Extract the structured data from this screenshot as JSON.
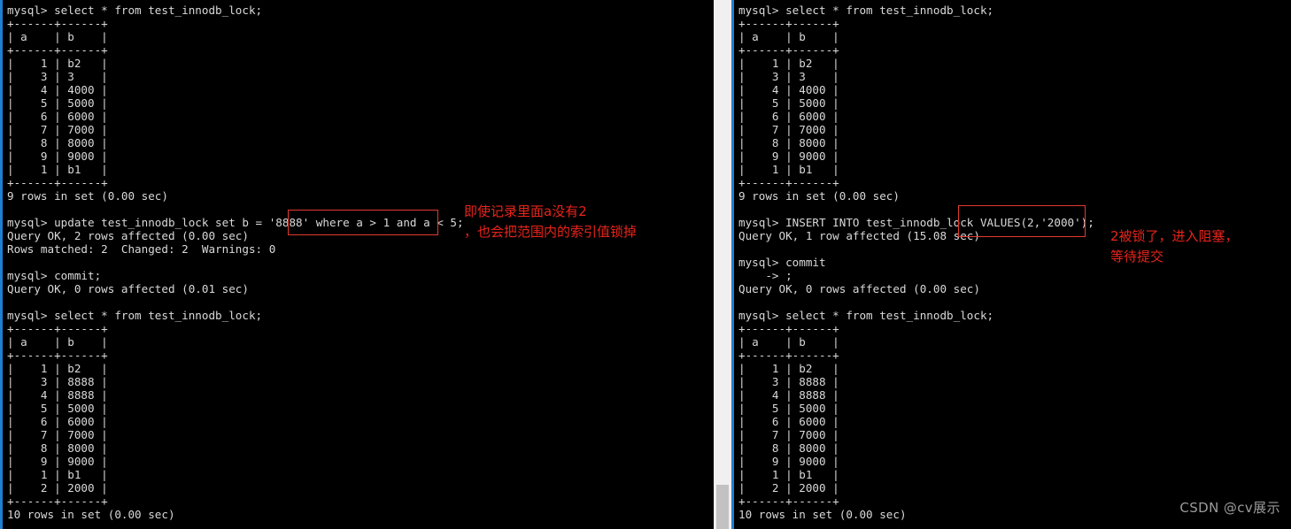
{
  "meta": {
    "watermark": "CSDN @cv展示"
  },
  "colors": {
    "terminal_background": "#000000",
    "terminal_text": "#d9d9d9",
    "pane_border": "#1f7fd0",
    "annotation_red": "#e8241b",
    "box_red": "#e23a2e",
    "scrollbar_track": "#f0f0f0",
    "scrollbar_thumb": "#c2c2c2",
    "watermark_text": "#9b9b9b"
  },
  "left_pane": {
    "name": "session-a-terminal",
    "session_text": "mysql> select * from test_innodb_lock;\n+------+------+\n| a    | b    |\n+------+------+\n|    1 | b2   |\n|    3 | 3    |\n|    4 | 4000 |\n|    5 | 5000 |\n|    6 | 6000 |\n|    7 | 7000 |\n|    8 | 8000 |\n|    9 | 9000 |\n|    1 | b1   |\n+------+------+\n9 rows in set (0.00 sec)\n\nmysql> update test_innodb_lock set b = '8888' where a > 1 and a < 5;\nQuery OK, 2 rows affected (0.00 sec)\nRows matched: 2  Changed: 2  Warnings: 0\n\nmysql> commit;\nQuery OK, 0 rows affected (0.01 sec)\n\nmysql> select * from test_innodb_lock;\n+------+------+\n| a    | b    |\n+------+------+\n|    1 | b2   |\n|    3 | 8888 |\n|    4 | 8888 |\n|    5 | 5000 |\n|    6 | 6000 |\n|    7 | 7000 |\n|    8 | 8000 |\n|    9 | 9000 |\n|    1 | b1   |\n|    2 | 2000 |\n+------+------+\n10 rows in set (0.00 sec)",
    "commands": [
      {
        "prompt": "mysql>",
        "sql": "select * from test_innodb_lock;",
        "result_table": {
          "headers": [
            "a",
            "b"
          ],
          "rows": [
            [
              "1",
              "b2"
            ],
            [
              "3",
              "3"
            ],
            [
              "4",
              "4000"
            ],
            [
              "5",
              "5000"
            ],
            [
              "6",
              "6000"
            ],
            [
              "7",
              "7000"
            ],
            [
              "8",
              "8000"
            ],
            [
              "9",
              "9000"
            ],
            [
              "1",
              "b1"
            ]
          ]
        },
        "status": "9 rows in set (0.00 sec)"
      },
      {
        "prompt": "mysql>",
        "sql": "update test_innodb_lock set b = '8888' where a > 1 and a < 5;",
        "status": "Query OK, 2 rows affected (0.00 sec)",
        "extra": "Rows matched: 2  Changed: 2  Warnings: 0"
      },
      {
        "prompt": "mysql>",
        "sql": "commit;",
        "status": "Query OK, 0 rows affected (0.01 sec)"
      },
      {
        "prompt": "mysql>",
        "sql": "select * from test_innodb_lock;",
        "result_table": {
          "headers": [
            "a",
            "b"
          ],
          "rows": [
            [
              "1",
              "b2"
            ],
            [
              "3",
              "8888"
            ],
            [
              "4",
              "8888"
            ],
            [
              "5",
              "5000"
            ],
            [
              "6",
              "6000"
            ],
            [
              "7",
              "7000"
            ],
            [
              "8",
              "8000"
            ],
            [
              "9",
              "9000"
            ],
            [
              "1",
              "b1"
            ],
            [
              "2",
              "2000"
            ]
          ]
        },
        "status": "10 rows in set (0.00 sec)"
      }
    ],
    "highlight_box_text": "where a > 1 and a < 5;",
    "annotation": "即使记录里面a没有2\n，也会把范围内的索引值锁掉"
  },
  "right_pane": {
    "name": "session-b-terminal",
    "session_text": "mysql> select * from test_innodb_lock;\n+------+------+\n| a    | b    |\n+------+------+\n|    1 | b2   |\n|    3 | 3    |\n|    4 | 4000 |\n|    5 | 5000 |\n|    6 | 6000 |\n|    7 | 7000 |\n|    8 | 8000 |\n|    9 | 9000 |\n|    1 | b1   |\n+------+------+\n9 rows in set (0.00 sec)\n\nmysql> INSERT INTO test_innodb_lock VALUES(2,'2000');\nQuery OK, 1 row affected (15.08 sec)\n\nmysql> commit\n    -> ;\nQuery OK, 0 rows affected (0.00 sec)\n\nmysql> select * from test_innodb_lock;\n+------+------+\n| a    | b    |\n+------+------+\n|    1 | b2   |\n|    3 | 8888 |\n|    4 | 8888 |\n|    5 | 5000 |\n|    6 | 6000 |\n|    7 | 7000 |\n|    8 | 8000 |\n|    9 | 9000 |\n|    1 | b1   |\n|    2 | 2000 |\n+------+------+\n10 rows in set (0.00 sec)",
    "commands": [
      {
        "prompt": "mysql>",
        "sql": "select * from test_innodb_lock;",
        "result_table": {
          "headers": [
            "a",
            "b"
          ],
          "rows": [
            [
              "1",
              "b2"
            ],
            [
              "3",
              "3"
            ],
            [
              "4",
              "4000"
            ],
            [
              "5",
              "5000"
            ],
            [
              "6",
              "6000"
            ],
            [
              "7",
              "7000"
            ],
            [
              "8",
              "8000"
            ],
            [
              "9",
              "9000"
            ],
            [
              "1",
              "b1"
            ]
          ]
        },
        "status": "9 rows in set (0.00 sec)"
      },
      {
        "prompt": "mysql>",
        "sql": "INSERT INTO test_innodb_lock VALUES(2,'2000');",
        "status": "Query OK, 1 row affected (15.08 sec)"
      },
      {
        "prompt": "mysql>",
        "sql": "commit",
        "continuation": "    -> ;",
        "status": "Query OK, 0 rows affected (0.00 sec)"
      },
      {
        "prompt": "mysql>",
        "sql": "select * from test_innodb_lock;",
        "result_table": {
          "headers": [
            "a",
            "b"
          ],
          "rows": [
            [
              "1",
              "b2"
            ],
            [
              "3",
              "8888"
            ],
            [
              "4",
              "8888"
            ],
            [
              "5",
              "5000"
            ],
            [
              "6",
              "6000"
            ],
            [
              "7",
              "7000"
            ],
            [
              "8",
              "8000"
            ],
            [
              "9",
              "9000"
            ],
            [
              "1",
              "b1"
            ],
            [
              "2",
              "2000"
            ]
          ]
        },
        "status": "10 rows in set (0.00 sec)"
      }
    ],
    "highlight_box_text": "VALUES(2,'2000');",
    "annotation": "2被锁了，进入阻塞，\n等待提交"
  }
}
